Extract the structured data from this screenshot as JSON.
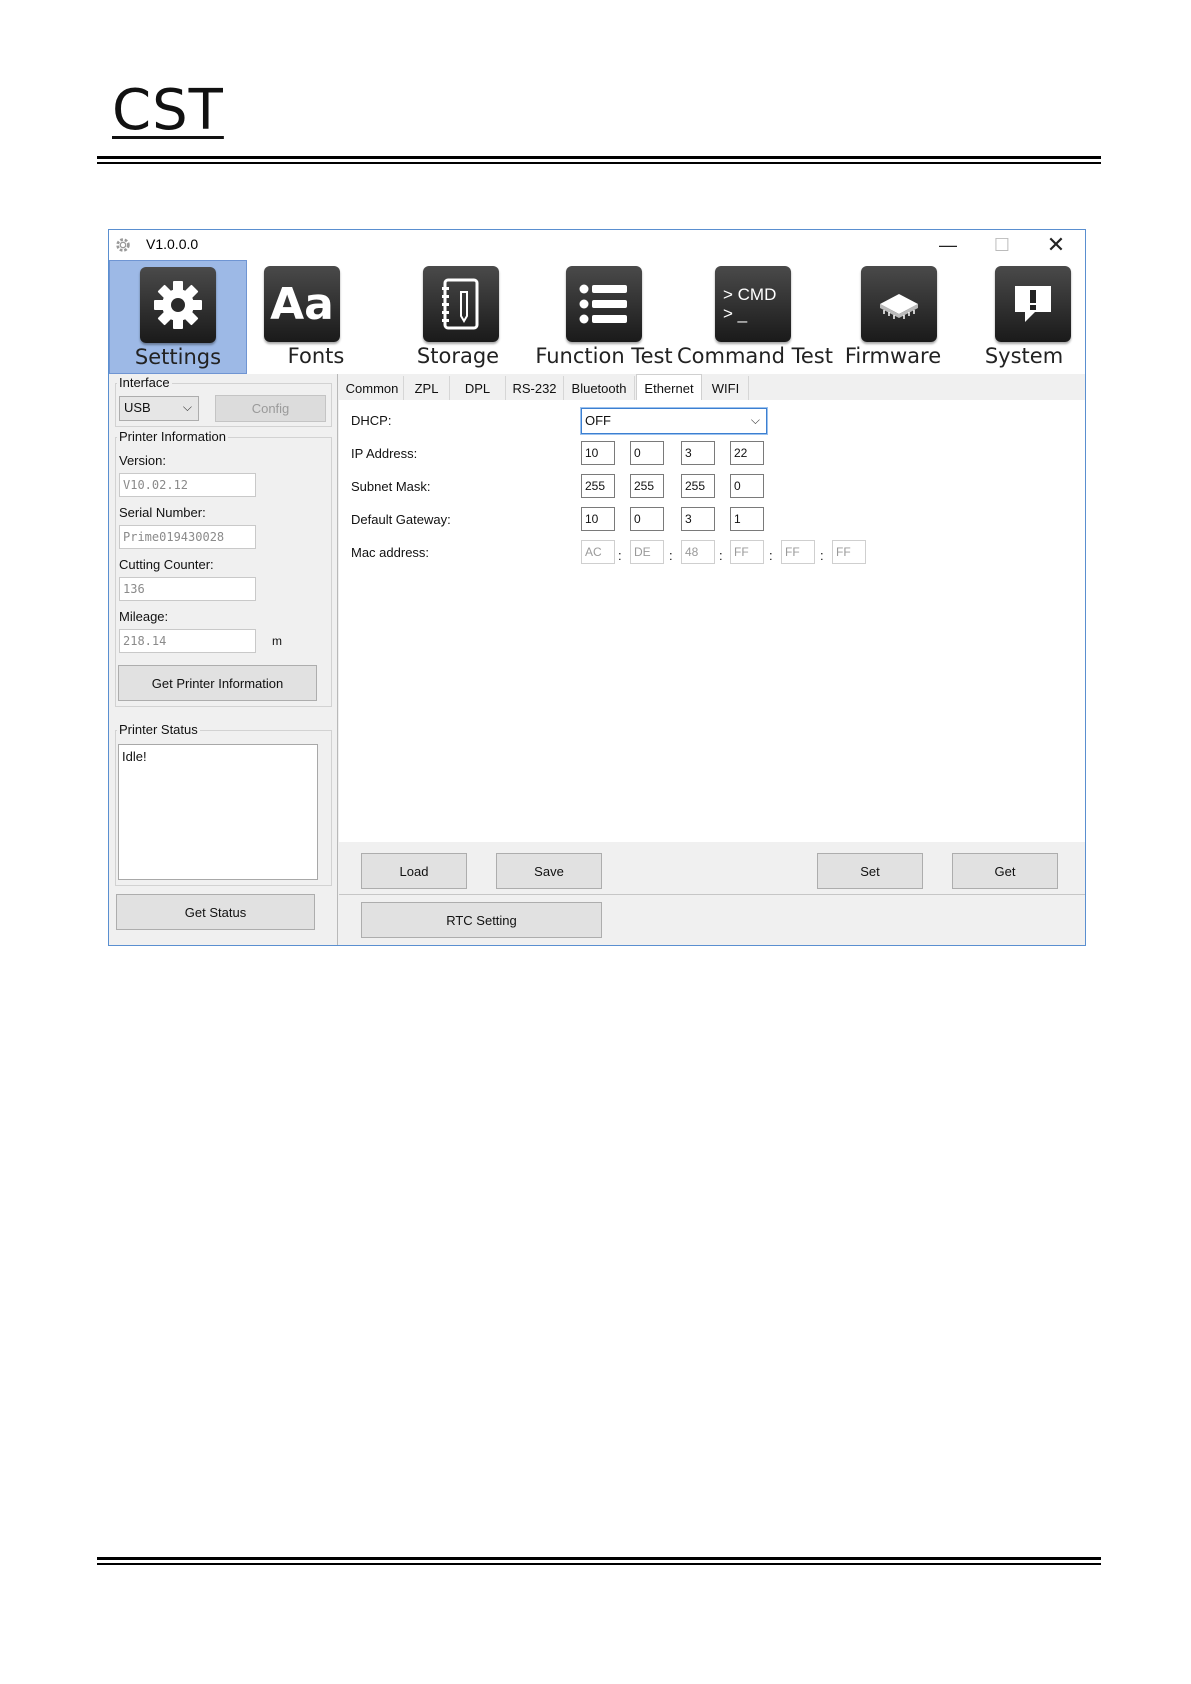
{
  "document": {
    "logo_text": "CST"
  },
  "window": {
    "title": "V1.0.0.0",
    "controls": {
      "minimize": "—",
      "maximize": "☐",
      "close": "✕"
    }
  },
  "toolbar": {
    "items": [
      {
        "label": "Settings",
        "icon": "gear-icon",
        "active": true
      },
      {
        "label": "Fonts",
        "icon": "font-icon",
        "glyph": "Aa"
      },
      {
        "label": "Storage",
        "icon": "notebook-icon"
      },
      {
        "label": "Function Test",
        "icon": "list-icon"
      },
      {
        "label": "Command Test",
        "icon": "terminal-icon",
        "glyph_line1": "> CMD",
        "glyph_line2": "> _"
      },
      {
        "label": "Firmware",
        "icon": "chip-icon"
      },
      {
        "label": "System",
        "icon": "alert-message-icon",
        "glyph": "!"
      }
    ]
  },
  "left_panel": {
    "interface": {
      "title": "Interface",
      "selected": "USB",
      "config_button": "Config"
    },
    "printer_info": {
      "title": "Printer Information",
      "version_label": "Version:",
      "version_value": "V10.02.12",
      "serial_label": "Serial Number:",
      "serial_value": "Prime019430028",
      "cutting_label": "Cutting Counter:",
      "cutting_value": "136",
      "mileage_label": "Mileage:",
      "mileage_value": "218.14",
      "mileage_unit": "m",
      "get_info_button": "Get Printer Information"
    },
    "printer_status": {
      "title": "Printer Status",
      "status_text": "Idle!",
      "get_status_button": "Get Status"
    }
  },
  "tabs": [
    "Common",
    "ZPL",
    "DPL",
    "RS-232",
    "Bluetooth",
    "Ethernet",
    "WIFI"
  ],
  "active_tab": "Ethernet",
  "ethernet": {
    "dhcp_label": "DHCP:",
    "dhcp_value": "OFF",
    "ip_label": "IP Address:",
    "ip": [
      "10",
      "0",
      "3",
      "22"
    ],
    "subnet_label": "Subnet Mask:",
    "subnet": [
      "255",
      "255",
      "255",
      "0"
    ],
    "gateway_label": "Default Gateway:",
    "gateway": [
      "10",
      "0",
      "3",
      "1"
    ],
    "mac_label": "Mac address:",
    "mac": [
      "AC",
      "DE",
      "48",
      "FF",
      "FF",
      "FF"
    ],
    "mac_separator": ":"
  },
  "buttons": {
    "load": "Load",
    "save": "Save",
    "set": "Set",
    "get": "Get",
    "rtc": "RTC Setting"
  }
}
